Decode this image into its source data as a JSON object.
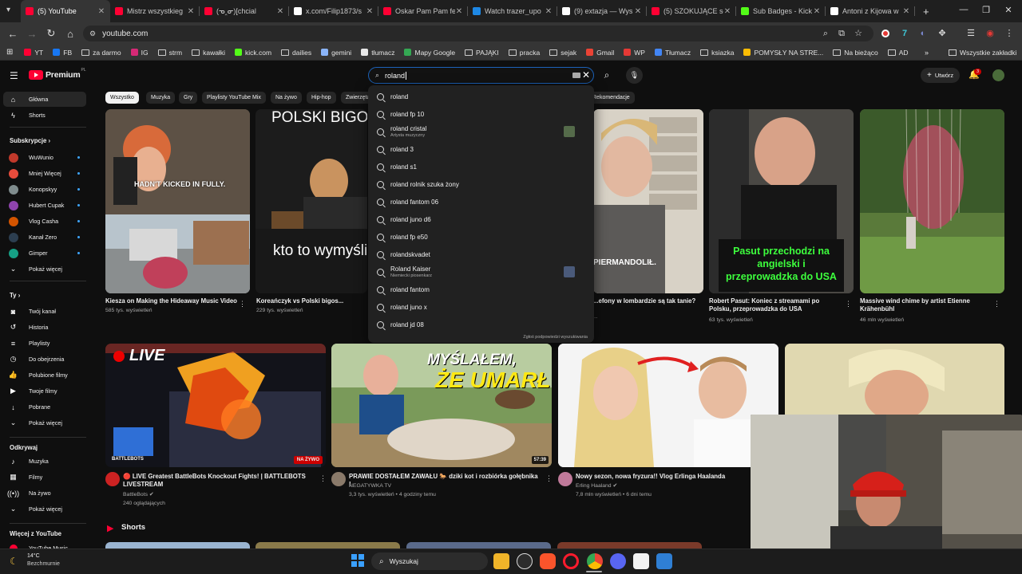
{
  "browser": {
    "tabs": [
      {
        "title": "(5) YouTube",
        "color": "#ff0033",
        "active": true
      },
      {
        "title": "Mistrz wszystkieg",
        "color": "#ff0033"
      },
      {
        "title": "(ᓀ‸ᓂ)[chcial",
        "color": "#ff0033"
      },
      {
        "title": "x.com/Filip1873/s",
        "color": "#ffffff"
      },
      {
        "title": "Oskar Pam Pam fe",
        "color": "#ff0033"
      },
      {
        "title": "Watch trazer_upo",
        "color": "#1e88e5"
      },
      {
        "title": "(9) extazja — Wys",
        "color": "#ffffff"
      },
      {
        "title": "(5) SZOKUJĄCE sł",
        "color": "#ff0033"
      },
      {
        "title": "Sub Badges - Kick",
        "color": "#53fc18"
      },
      {
        "title": "Antoni z Kijowa w",
        "color": "#ffffff"
      }
    ],
    "new_tab": "+",
    "url": "youtube.com",
    "bookmarks": [
      {
        "label": "YT",
        "color": "#ff0033",
        "kind": "icon"
      },
      {
        "label": "FB",
        "color": "#1877f2",
        "kind": "icon"
      },
      {
        "label": "za darmo",
        "kind": "folder"
      },
      {
        "label": "IG",
        "color": "#d62976",
        "kind": "icon"
      },
      {
        "label": "strm",
        "kind": "folder"
      },
      {
        "label": "kawałki",
        "kind": "folder"
      },
      {
        "label": "kick.com",
        "color": "#53fc18",
        "kind": "icon"
      },
      {
        "label": "dailies",
        "kind": "folder"
      },
      {
        "label": "gemini",
        "color": "#8ab4f8",
        "kind": "icon"
      },
      {
        "label": "tłumacz",
        "color": "#e8e8e8",
        "kind": "icon"
      },
      {
        "label": "Mapy Google",
        "color": "#34a853",
        "kind": "icon"
      },
      {
        "label": "PAJĄKI",
        "kind": "folder"
      },
      {
        "label": "pracka",
        "kind": "folder"
      },
      {
        "label": "sejak",
        "kind": "folder"
      },
      {
        "label": "Gmail",
        "color": "#ea4335",
        "kind": "icon"
      },
      {
        "label": "WP",
        "color": "#e53935",
        "kind": "icon"
      },
      {
        "label": "Tłumacz",
        "color": "#4285f4",
        "kind": "icon"
      },
      {
        "label": "ksiazka",
        "kind": "folder"
      },
      {
        "label": "POMYSŁY NA STRE...",
        "color": "#fbbc04",
        "kind": "icon"
      },
      {
        "label": "Na bieżąco",
        "kind": "folder"
      },
      {
        "label": "AD",
        "kind": "folder"
      }
    ],
    "all_bookmarks": "Wszystkie zakładki"
  },
  "yt": {
    "logo": "Premium",
    "logo_region": "PL",
    "search_query": "roland",
    "create_label": "Utwórz",
    "notif_count": "3",
    "chips": [
      "Wszystko",
      "Muzyka",
      "Gry",
      "Playlisty YouTube Mix",
      "Na żywo",
      "Hip-hop",
      "Zwierzęta",
      "Rekomendacje"
    ],
    "sidebar": {
      "home": "Główna",
      "shorts": "Shorts",
      "subs_header": "Subskrypcje",
      "subs": [
        {
          "name": "WuWunio",
          "color": "#c0392b"
        },
        {
          "name": "Mniej Więcej",
          "color": "#e74c3c"
        },
        {
          "name": "Konopskyy",
          "color": "#7f8c8d"
        },
        {
          "name": "Hubert Cupak",
          "color": "#8e44ad"
        },
        {
          "name": "Vlog Casha",
          "color": "#d35400"
        },
        {
          "name": "Kanał Zero",
          "color": "#2c3e50"
        },
        {
          "name": "Gimper",
          "color": "#16a085"
        }
      ],
      "show_more": "Pokaż więcej",
      "you_header": "Ty",
      "you": [
        "Twój kanał",
        "Historia",
        "Playlisty",
        "Do obejrzenia",
        "Polubione filmy",
        "Twoje filmy",
        "Pobrane",
        "Pokaż więcej"
      ],
      "explore_header": "Odkrywaj",
      "explore": [
        "Muzyka",
        "Filmy",
        "Na żywo",
        "Pokaż więcej"
      ],
      "more_header": "Więcej z YouTube",
      "more": [
        "YouTube Music"
      ]
    },
    "suggestions": [
      {
        "text": "roland"
      },
      {
        "text": "roland fp 10"
      },
      {
        "text": "roland cristal",
        "sub": "Artysta muzyczny"
      },
      {
        "text": "roland 3"
      },
      {
        "text": "roland s1"
      },
      {
        "text": "roland rolnik szuka żony"
      },
      {
        "text": "roland fantom 06"
      },
      {
        "text": "roland juno d6"
      },
      {
        "text": "roland fp e50"
      },
      {
        "text": "rolandskvadet"
      },
      {
        "text": "Roland Kaiser",
        "sub": "Niemiecki piosenkarz"
      },
      {
        "text": "roland fantom"
      },
      {
        "text": "roland juno x"
      },
      {
        "text": "roland jd 08"
      }
    ],
    "report": "Zgłoś podpowiedzi wyszukiwania",
    "row1": [
      {
        "title": "Kiesza on Making the Hideaway Music Video",
        "meta": "585 tys. wyświetleń",
        "overlay": "HADN'T KICKED IN FULLY."
      },
      {
        "title": "Koreańczyk vs Polski bigos...",
        "meta": "229 tys. wyświetleń",
        "overlay_top": "POLSKI BIGOS",
        "overlay_bottom": "kto to wymyślił"
      },
      {
        "title": "...efony w lombardzie są tak tanie?",
        "meta": "...",
        "overlay": "PIERMANDOLIŁ."
      },
      {
        "title": "Robert Pasut: Koniec z streamami po Polsku, przeprowadzka do USA",
        "meta": "63 tys. wyświetleń",
        "overlay": "Pasut przechodzi na angielski i przeprowadzka do USA"
      },
      {
        "title": "Massive wind chime by artist Etienne Krähenbühl",
        "meta": "46 mln wyświetleń"
      }
    ],
    "row2": [
      {
        "title": "🔴 LIVE Greatest BattleBots Knockout Fights! | BATTLEBOTS LIVESTREAM",
        "channel": "BattleBots ✔",
        "meta": "240 oglądających",
        "badge": "NA ŻYWO",
        "overlay": "LIVE",
        "logo": "BATTLEBOTS"
      },
      {
        "title": "PRAWIE DOSTAŁEM ZAWAŁU 🐎 dziki kot i rozbiórka gołębnika !",
        "channel": "NEGATYWKA TV",
        "meta": "3,3 tys. wyświetleń • 4 godziny temu",
        "badge": "57:39",
        "overlay_a": "MYŚLAŁEM,",
        "overlay_b": "ŻE UMARŁ"
      },
      {
        "title": "Nowy sezon, nowa fryzura!! Vlog Erlinga Haalanda",
        "channel": "Erling Haaland ✔",
        "meta": "7,8 mln wyświetleń • 6 dni temu"
      }
    ],
    "shorts_header": "Shorts"
  },
  "taskbar": {
    "weather_temp": "14°C",
    "weather_desc": "Bezchmurnie",
    "search": "Wyszukaj"
  }
}
